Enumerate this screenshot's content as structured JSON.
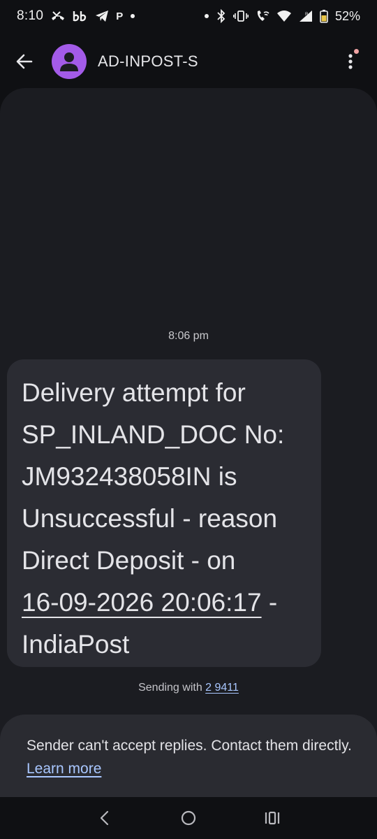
{
  "status_bar": {
    "time": "8:10",
    "left_icons": [
      "missed-call-icon",
      "bb-app-icon",
      "telegram-icon",
      "p-app-icon",
      "notification-dot-icon"
    ],
    "left_text_icon": "b",
    "p_text_icon": "P",
    "right_icons": [
      "dot-icon",
      "bluetooth-icon",
      "vibrate-icon",
      "wifi-calling-icon",
      "wifi-icon",
      "signal-icon",
      "battery-icon"
    ],
    "battery": "52%"
  },
  "app_bar": {
    "sender": "AD-INPOST-S"
  },
  "conversation": {
    "timestamp": "8:06 pm",
    "message": {
      "lines": [
        "Delivery attempt for",
        "SP_INLAND_DOC No:",
        "JM932438058IN is",
        "Unsuccessful - reason",
        "Direct Deposit - on"
      ],
      "date_link": "16-09-2026 20:06:17",
      "date_suffix": " -",
      "last_line": "IndiaPost"
    },
    "sending_with_label": "Sending with ",
    "sending_with_number": "2 9411"
  },
  "info_card": {
    "text": "Sender can't accept replies. Contact them directly. ",
    "link": "Learn more"
  },
  "colors": {
    "background": "#0f1013",
    "panel": "#1b1c21",
    "bubble": "#2b2c33",
    "avatar": "#a35be8",
    "link": "#a9c7ff"
  }
}
